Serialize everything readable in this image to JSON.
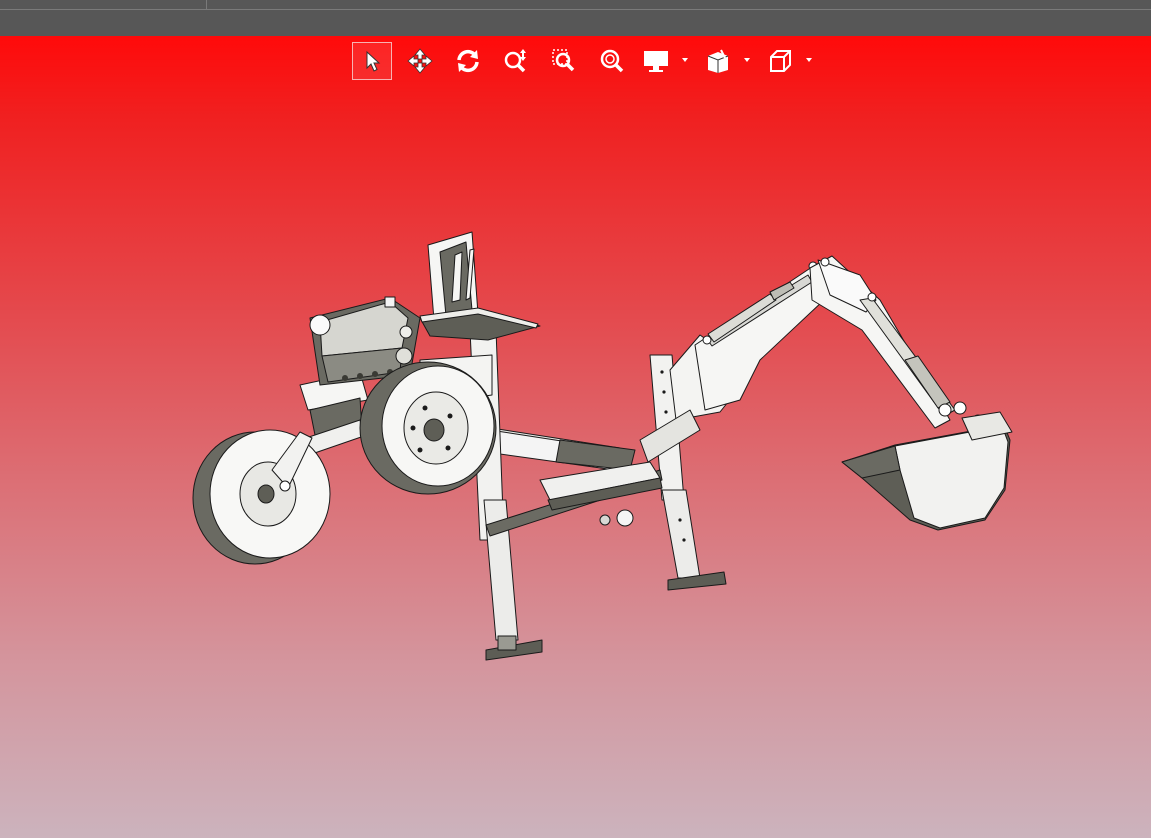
{
  "app": {
    "accent": "#ff0a0a",
    "topbar_color": "#575757"
  },
  "viewport": {
    "background_top": "#ff0a0a",
    "background_bottom": "#ccb3bd"
  },
  "toolbar": {
    "tools": [
      {
        "id": "select",
        "icon": "cursor-arrow-icon",
        "active": true
      },
      {
        "id": "pan",
        "icon": "pan-arrows-icon",
        "active": false
      },
      {
        "id": "rotate",
        "icon": "rotate-icon",
        "active": false
      },
      {
        "id": "zoom",
        "icon": "zoom-icon",
        "active": false
      },
      {
        "id": "zoom-window",
        "icon": "zoom-window-icon",
        "active": false
      },
      {
        "id": "zoom-fit",
        "icon": "zoom-fit-icon",
        "active": false
      },
      {
        "id": "display-mode",
        "icon": "monitor-icon",
        "active": false,
        "dropdown": true
      },
      {
        "id": "section",
        "icon": "section-view-icon",
        "active": false,
        "dropdown": true
      },
      {
        "id": "view-orientation",
        "icon": "cube-view-icon",
        "active": false,
        "dropdown": true
      }
    ]
  },
  "model": {
    "description_icon": "backhoe-model",
    "colors": {
      "body": "#f4f4f4",
      "shade": "#bfbfb7",
      "dark": "#5d5d55",
      "edge": "#1a1a1a"
    }
  }
}
